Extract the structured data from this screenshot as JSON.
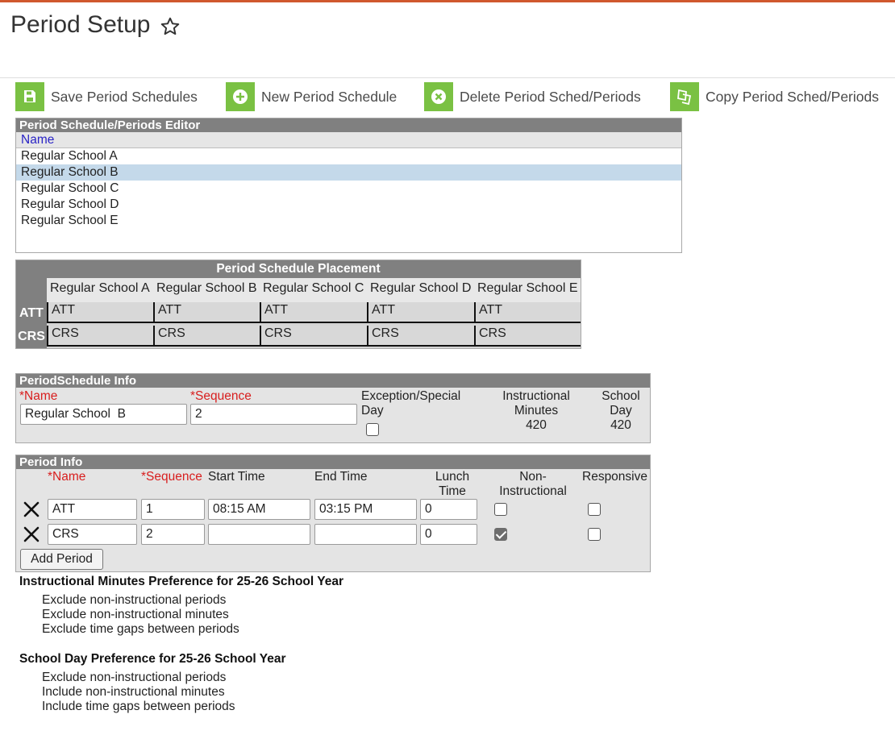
{
  "page": {
    "title": "Period Setup",
    "accent": "#d0582e"
  },
  "toolbar": {
    "icon_color": "#7ac143",
    "save_label": "Save Period Schedules",
    "new_label": "New Period Schedule",
    "delete_label": "Delete Period Sched/Periods",
    "copy_label": "Copy Period Sched/Periods"
  },
  "editor": {
    "title": "Period Schedule/Periods Editor",
    "column_header": "Name",
    "rows": [
      "Regular School A",
      "Regular School B",
      "Regular School C",
      "Regular School D",
      "Regular School E"
    ],
    "selected": "Regular School B"
  },
  "placement": {
    "title": "Period Schedule Placement",
    "columns": [
      "Regular School A",
      "Regular School B",
      "Regular School C",
      "Regular School D",
      "Regular School E"
    ],
    "rows": [
      {
        "label": "ATT",
        "values": [
          "ATT",
          "ATT",
          "ATT",
          "ATT",
          "ATT"
        ]
      },
      {
        "label": "CRS",
        "values": [
          "CRS",
          "CRS",
          "CRS",
          "CRS",
          "CRS"
        ]
      }
    ]
  },
  "schedule_info": {
    "title": "PeriodSchedule Info",
    "name_label": "*Name",
    "sequence_label": "*Sequence",
    "exception_label_1": "Exception/Special",
    "exception_label_2": "Day",
    "instr_label_1": "Instructional",
    "instr_label_2": "Minutes",
    "instr_value": "420",
    "school_label_1": "School",
    "school_label_2": "Day",
    "school_value": "420",
    "name_value": "Regular School  B",
    "sequence_value": "2",
    "exception_checked": false
  },
  "period_info": {
    "title": "Period Info",
    "headers": {
      "name": "*Name",
      "sequence": "*Sequence",
      "start": "Start Time",
      "end": "End Time",
      "lunch_1": "Lunch",
      "lunch_2": "Time",
      "non_instr_1": "Non-",
      "non_instr_2": "Instructional",
      "responsive": "Responsive"
    },
    "rows": [
      {
        "name": "ATT",
        "sequence": "1",
        "start": "08:15 AM",
        "end": "03:15 PM",
        "lunch": "0",
        "non_instructional": false,
        "responsive": false
      },
      {
        "name": "CRS",
        "sequence": "2",
        "start": "",
        "end": "",
        "lunch": "0",
        "non_instructional": true,
        "responsive": false
      }
    ],
    "add_label": "Add Period"
  },
  "preferences": {
    "instructional": {
      "title": "Instructional Minutes Preference for 25-26 School Year",
      "items": [
        "Exclude non-instructional periods",
        "Exclude non-instructional minutes",
        "Exclude time gaps between periods"
      ]
    },
    "school_day": {
      "title": "School Day Preference for 25-26 School Year",
      "items": [
        "Exclude non-instructional periods",
        "Include non-instructional minutes",
        "Include time gaps between periods"
      ]
    }
  }
}
